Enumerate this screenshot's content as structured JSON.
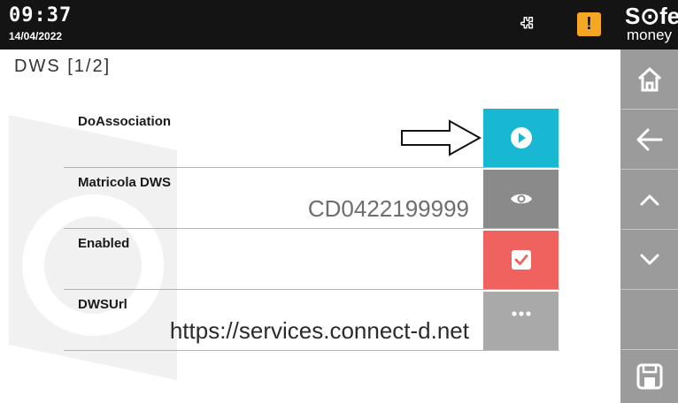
{
  "status": {
    "time": "09:37",
    "date": "14/04/2022",
    "warning_glyph": "!"
  },
  "brand": {
    "line1": "S⊙fe",
    "line2": "money"
  },
  "page": {
    "title": "DWS [1/2]"
  },
  "rows": [
    {
      "label": "DoAssociation",
      "value": "",
      "action_icon": "play-icon",
      "action_color": "#19b8d2"
    },
    {
      "label": "Matricola DWS",
      "value": "CD0422199999",
      "action_icon": "eye-icon",
      "action_color": "#8a8a8a"
    },
    {
      "label": "Enabled",
      "value": "",
      "action_icon": "checkbox-checked-icon",
      "action_color": "#f0625d"
    },
    {
      "label": "DWSUrl",
      "value": "https://services.connect-d.net",
      "action_icon": "more-icon",
      "action_color": "#a9a9a9"
    }
  ],
  "sidebar": {
    "items": [
      "home-icon",
      "back-arrow-icon",
      "chevron-up-icon",
      "chevron-down-icon",
      "empty",
      "save-icon"
    ]
  },
  "colors": {
    "topbar": "#141414",
    "sidebar": "#9b9b9b",
    "warning": "#f5a623"
  }
}
